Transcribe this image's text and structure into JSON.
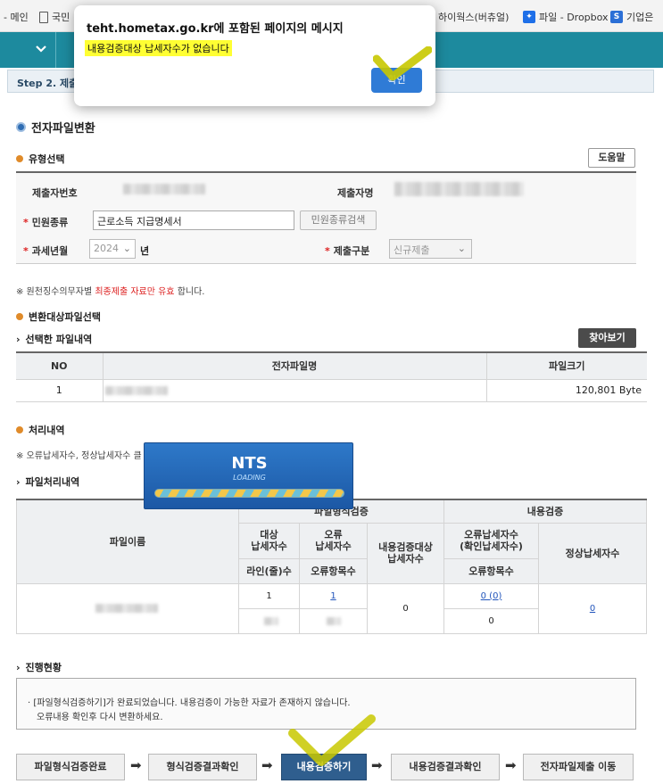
{
  "bookmarks": [
    {
      "icon": "",
      "label": "- 메인"
    },
    {
      "icon": "page-icon",
      "label": "국민"
    },
    {
      "icon": "",
      "label": "하이웍스(버츄얼)"
    },
    {
      "icon": "dropbox-icon",
      "label": "파일 - Dropbox"
    },
    {
      "icon": "s-icon",
      "label": "기업은"
    }
  ],
  "step_label": "Step 2. 제출",
  "page_title": "전자파일변환",
  "type_select": {
    "title": "유형선택",
    "help_button": "도움말",
    "submitter_no_label": "제출자번호",
    "submitter_name_label": "제출자명",
    "civil_type_label": "민원종류",
    "civil_type_value": "근로소득 지급명세서",
    "civil_type_search_button": "민원종류검색",
    "tax_year_label": "과세년월",
    "tax_year_value": "2024",
    "year_unit": "년",
    "submit_type_label": "제출구분",
    "submit_type_value": "신규제출"
  },
  "notice1": {
    "prefix": "※ 원천징수의무자별 ",
    "highlight": "최종제출 자료만 유효",
    "suffix": " 합니다."
  },
  "file_select": {
    "title": "변환대상파일선택",
    "subtitle": "선택한 파일내역",
    "browse_button": "찾아보기",
    "headers": [
      "NO",
      "전자파일명",
      "파일크기"
    ],
    "row": {
      "no": "1",
      "size": "120,801 Byte"
    }
  },
  "process": {
    "title": "처리내역",
    "note": "※ 오류납세자수, 정상납세자수 클",
    "subtitle": "파일처리내역",
    "group_format": "파일형식검증",
    "group_content": "내용검증",
    "col_filename": "파일이름",
    "col_target": "대상\n납세자수",
    "col_error": "오류\n납세자수",
    "col_content_target": "내용검증대상\n납세자수",
    "col_error_payer": "오류납세자수\n(확인납세자수)",
    "col_normal": "정상납세자수",
    "col_lines": "라인(줄)수",
    "col_error_items": "오류항목수",
    "col_error_items2": "오류항목수",
    "val_target": "1",
    "val_error": "1",
    "val_content_target": "0",
    "val_error_payer": "0 (0)",
    "val_normal": "0",
    "val_error_items2": "0"
  },
  "progress": {
    "title": "진행현황",
    "line1": "· [파일형식검증하기]가 완료되었습니다. 내용검증이 가능한 자료가 존재하지 않습니다.",
    "line2": "오류내용 확인후 다시 변환하세요."
  },
  "flow": [
    "파일형식검증완료",
    "형식검증결과확인",
    "내용검증하기",
    "내용검증결과확인",
    "전자파일제출 이동"
  ],
  "loading": {
    "brand": "NTS",
    "text": "LOADING"
  },
  "dialog": {
    "title": "teht.hometax.go.kr에 포함된 페이지의 메시지",
    "message": "내용검증대상 납세자수가 없습니다",
    "ok": "확인"
  },
  "colors": {
    "teal": "#1d8a9e",
    "accent_blue": "#2f5e8e",
    "dialog_ok": "#2f7bd6",
    "highlight": "#ffff33",
    "check_mark": "#c8c800"
  }
}
